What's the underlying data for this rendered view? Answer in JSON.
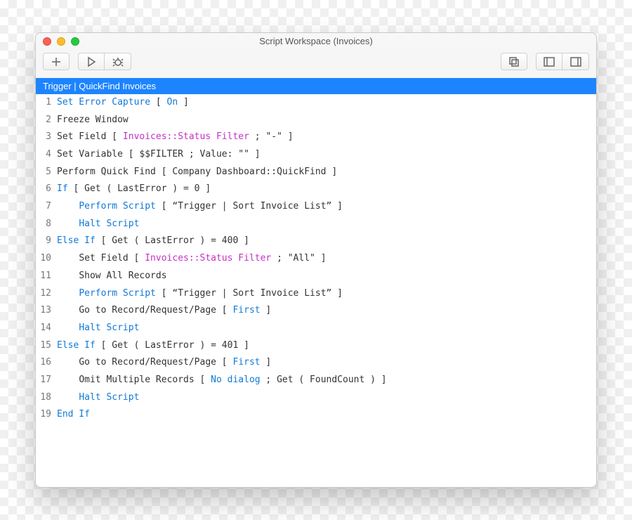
{
  "window": {
    "title": "Script Workspace (Invoices)"
  },
  "header": {
    "script_name": "Trigger | QuickFind Invoices"
  },
  "lines": [
    {
      "num": "1",
      "indent": 0,
      "segs": [
        {
          "t": "Set Error Capture",
          "c": "kw"
        },
        {
          "t": " [ "
        },
        {
          "t": "On",
          "c": "kw"
        },
        {
          "t": " ]"
        }
      ]
    },
    {
      "num": "2",
      "indent": 0,
      "segs": [
        {
          "t": "Freeze Window"
        }
      ]
    },
    {
      "num": "3",
      "indent": 0,
      "segs": [
        {
          "t": "Set Field [ "
        },
        {
          "t": "Invoices::Status Filter",
          "c": "field"
        },
        {
          "t": " ; \"-\" ]"
        }
      ]
    },
    {
      "num": "4",
      "indent": 0,
      "segs": [
        {
          "t": "Set Variable [ $$FILTER ; Value: \"\" ]"
        }
      ]
    },
    {
      "num": "5",
      "indent": 0,
      "segs": [
        {
          "t": "Perform Quick Find [ Company Dashboard::QuickFind ]"
        }
      ]
    },
    {
      "num": "6",
      "indent": 0,
      "segs": [
        {
          "t": "If",
          "c": "kw"
        },
        {
          "t": " [ Get ( LastError ) = 0 ]"
        }
      ]
    },
    {
      "num": "7",
      "indent": 1,
      "segs": [
        {
          "t": "Perform Script",
          "c": "kw"
        },
        {
          "t": " [ “Trigger | Sort Invoice List” ]"
        }
      ]
    },
    {
      "num": "8",
      "indent": 1,
      "segs": [
        {
          "t": "Halt Script",
          "c": "kw"
        }
      ]
    },
    {
      "num": "9",
      "indent": 0,
      "segs": [
        {
          "t": "Else If",
          "c": "kw"
        },
        {
          "t": " [ Get ( LastError ) = 400 ]"
        }
      ]
    },
    {
      "num": "10",
      "indent": 1,
      "segs": [
        {
          "t": "Set Field [ "
        },
        {
          "t": "Invoices::Status Filter",
          "c": "field"
        },
        {
          "t": " ; \"All\" ]"
        }
      ]
    },
    {
      "num": "11",
      "indent": 1,
      "segs": [
        {
          "t": "Show All Records"
        }
      ]
    },
    {
      "num": "12",
      "indent": 1,
      "segs": [
        {
          "t": "Perform Script",
          "c": "kw"
        },
        {
          "t": " [ “Trigger | Sort Invoice List” ]"
        }
      ]
    },
    {
      "num": "13",
      "indent": 1,
      "segs": [
        {
          "t": "Go to Record/Request/Page [ "
        },
        {
          "t": "First",
          "c": "kw"
        },
        {
          "t": " ]"
        }
      ]
    },
    {
      "num": "14",
      "indent": 1,
      "segs": [
        {
          "t": "Halt Script",
          "c": "kw"
        }
      ]
    },
    {
      "num": "15",
      "indent": 0,
      "segs": [
        {
          "t": "Else If",
          "c": "kw"
        },
        {
          "t": " [ Get ( LastError ) = 401 ]"
        }
      ]
    },
    {
      "num": "16",
      "indent": 1,
      "segs": [
        {
          "t": "Go to Record/Request/Page [ "
        },
        {
          "t": "First",
          "c": "kw"
        },
        {
          "t": " ]"
        }
      ]
    },
    {
      "num": "17",
      "indent": 1,
      "segs": [
        {
          "t": "Omit Multiple Records [ "
        },
        {
          "t": "No dialog",
          "c": "kw"
        },
        {
          "t": " ; Get ( FoundCount ) ]"
        }
      ]
    },
    {
      "num": "18",
      "indent": 1,
      "segs": [
        {
          "t": "Halt Script",
          "c": "kw"
        }
      ]
    },
    {
      "num": "19",
      "indent": 0,
      "segs": [
        {
          "t": "End If",
          "c": "kw"
        }
      ]
    }
  ]
}
